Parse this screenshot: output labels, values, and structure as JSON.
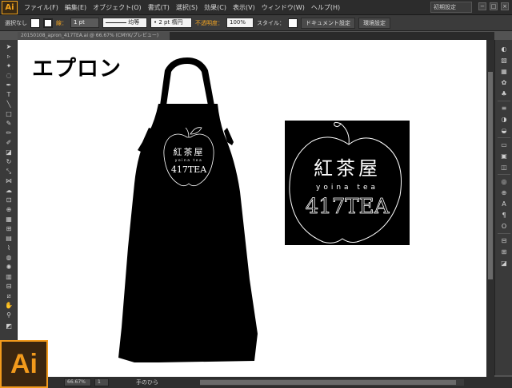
{
  "app": {
    "logo": "Ai",
    "menu": [
      "ファイル(F)",
      "編集(E)",
      "オブジェクト(O)",
      "書式(T)",
      "選択(S)",
      "効果(C)",
      "表示(V)",
      "ウィンドウ(W)",
      "ヘルプ(H)"
    ],
    "workspace": "初期設定",
    "window_controls": [
      "−",
      "□",
      "×"
    ]
  },
  "control_bar": {
    "selection": "選択なし",
    "stroke_label": "線：",
    "stroke_weight": "1 pt",
    "stroke_profile": "均等",
    "brush": "2 pt 楕円",
    "opacity_label": "不透明度：",
    "opacity": "100%",
    "style_label": "スタイル：",
    "doc_setup": "ドキュメント設定",
    "prefs": "環境設定"
  },
  "document": {
    "tab": "20150108_apron_417TEA.ai @ 66.67% (CMYK/プレビュー)"
  },
  "artboard": {
    "title": "エプロン",
    "logo_kanji": "紅茶屋",
    "logo_sub": "yoina tea",
    "logo_brand": "417TEA"
  },
  "status": {
    "zoom": "66.67%",
    "page": "1",
    "tool": "手のひら"
  },
  "colors": {
    "accent": "#f29a1c",
    "apron": "#000000",
    "artwork_line": "#ffffff"
  }
}
